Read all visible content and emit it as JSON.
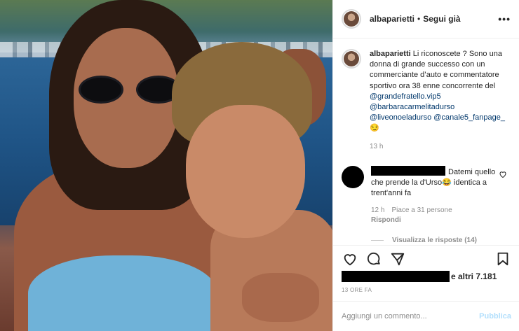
{
  "header": {
    "username": "albaparietti",
    "separator": "•",
    "follow_label": "Segui già",
    "more_label": "•••"
  },
  "caption": {
    "username": "albaparietti",
    "text": "Li riconoscete ? Sono una donna di grande successo con un commerciante d’auto e commentatore sportivo ora 38 enne concorrente del",
    "tags": [
      "@grandefratello.vip5",
      "@barbaracarmelitadurso",
      "@liveonoeladurso",
      "@canale5_fanpage_"
    ],
    "emoji": "😏",
    "time": "13 h"
  },
  "comment": {
    "text": "Datemi quello che prende la d'Urso😂 identica a trent'anni fa",
    "time": "12 h",
    "likes": "Piace a 31 persone",
    "reply_label": "Rispondi",
    "view_replies": "Visualizza le risposte (14)"
  },
  "likes": {
    "suffix": "e altri 7.181"
  },
  "posted": "13 ORE FA",
  "add_comment": {
    "placeholder": "Aggiungi un commento...",
    "publish_label": "Pubblica"
  },
  "icons": {
    "heart": "heart-icon",
    "comment": "comment-icon",
    "share": "share-icon",
    "bookmark": "bookmark-icon"
  },
  "colors": {
    "link": "#00376b",
    "muted": "#8e8e8e",
    "publish": "#b2dffc"
  }
}
